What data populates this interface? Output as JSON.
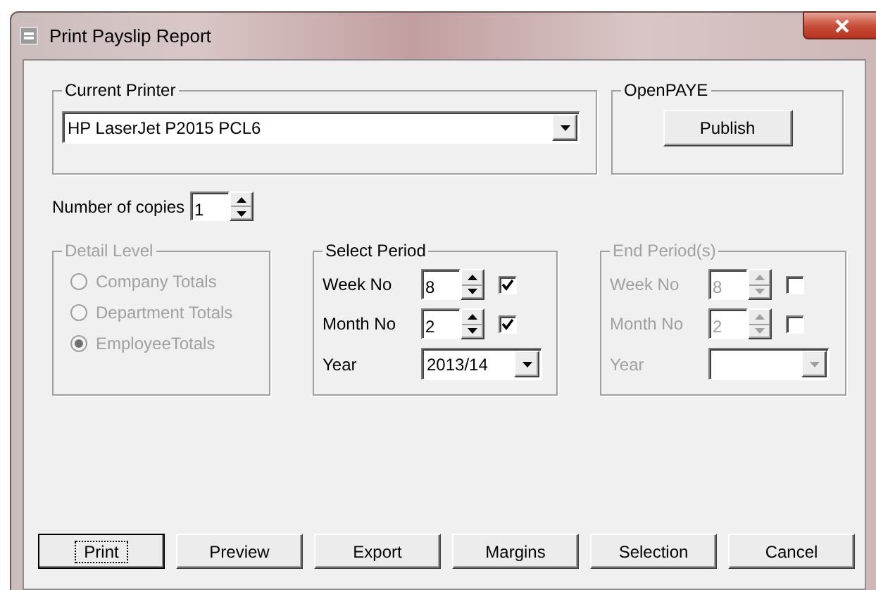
{
  "window": {
    "title": "Print Payslip Report"
  },
  "current_printer": {
    "label": "Current Printer",
    "value": "HP LaserJet P2015 PCL6"
  },
  "openpaye": {
    "label": "OpenPAYE",
    "button": "Publish"
  },
  "copies": {
    "label": "Number of copies",
    "value": "1"
  },
  "detail_level": {
    "label": "Detail Level",
    "disabled": true,
    "options": [
      {
        "label": "Company Totals",
        "selected": false
      },
      {
        "label": "Department Totals",
        "selected": false
      },
      {
        "label": "EmployeeTotals",
        "selected": true
      }
    ]
  },
  "select_period": {
    "label": "Select Period",
    "disabled": false,
    "rows": [
      {
        "kind": "spin",
        "label": "Week No",
        "value": "8",
        "checked": true
      },
      {
        "kind": "spin",
        "label": "Month No",
        "value": "2",
        "checked": true
      },
      {
        "kind": "combo",
        "label": "Year",
        "value": "2013/14"
      }
    ]
  },
  "end_period": {
    "label": "End Period(s)",
    "disabled": true,
    "rows": [
      {
        "kind": "spin",
        "label": "Week No",
        "value": "8",
        "checked": false
      },
      {
        "kind": "spin",
        "label": "Month No",
        "value": "2",
        "checked": false
      },
      {
        "kind": "combo",
        "label": "Year"
      }
    ]
  },
  "buttons": [
    {
      "label": "Print",
      "focused": true
    },
    {
      "label": "Preview",
      "focused": false
    },
    {
      "label": "Export",
      "focused": false
    },
    {
      "label": "Margins",
      "focused": false
    },
    {
      "label": "Selection",
      "focused": false
    },
    {
      "label": "Cancel",
      "focused": false
    }
  ]
}
